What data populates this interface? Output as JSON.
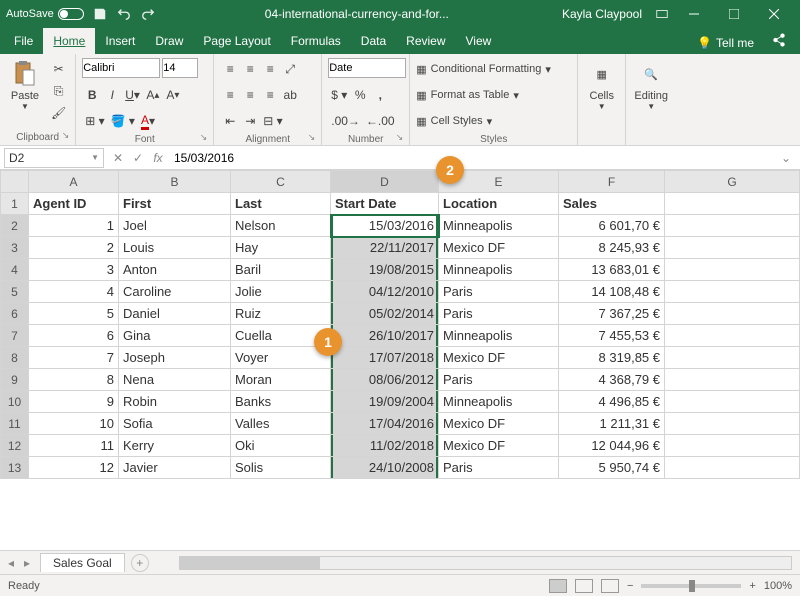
{
  "title": {
    "autosave": "AutoSave",
    "filename": "04-international-currency-and-for...",
    "user": "Kayla Claypool"
  },
  "tabs": {
    "file": "File",
    "home": "Home",
    "insert": "Insert",
    "draw": "Draw",
    "pagelayout": "Page Layout",
    "formulas": "Formulas",
    "data": "Data",
    "review": "Review",
    "view": "View",
    "tellme": "Tell me"
  },
  "ribbon": {
    "clipboard": {
      "paste": "Paste",
      "label": "Clipboard"
    },
    "font": {
      "name": "Calibri",
      "size": "14",
      "label": "Font"
    },
    "alignment": {
      "label": "Alignment"
    },
    "number": {
      "format": "Date",
      "label": "Number"
    },
    "styles": {
      "cond": "Conditional Formatting",
      "table": "Format as Table",
      "cell": "Cell Styles",
      "label": "Styles"
    },
    "cells": {
      "label": "Cells"
    },
    "editing": {
      "label": "Editing"
    }
  },
  "namebox": "D2",
  "formula": "15/03/2016",
  "columns": [
    "A",
    "B",
    "C",
    "D",
    "E",
    "F",
    "G"
  ],
  "headers": {
    "A": "Agent ID",
    "B": "First",
    "C": "Last",
    "D": "Start Date",
    "E": "Location",
    "F": "Sales"
  },
  "rows": [
    {
      "n": "2",
      "id": "1",
      "first": "Joel",
      "last": "Nelson",
      "date": "15/03/2016",
      "loc": "Minneapolis",
      "sales": "6 601,70 €"
    },
    {
      "n": "3",
      "id": "2",
      "first": "Louis",
      "last": "Hay",
      "date": "22/11/2017",
      "loc": "Mexico DF",
      "sales": "8 245,93 €"
    },
    {
      "n": "4",
      "id": "3",
      "first": "Anton",
      "last": "Baril",
      "date": "19/08/2015",
      "loc": "Minneapolis",
      "sales": "13 683,01 €"
    },
    {
      "n": "5",
      "id": "4",
      "first": "Caroline",
      "last": "Jolie",
      "date": "04/12/2010",
      "loc": "Paris",
      "sales": "14 108,48 €"
    },
    {
      "n": "6",
      "id": "5",
      "first": "Daniel",
      "last": "Ruiz",
      "date": "05/02/2014",
      "loc": "Paris",
      "sales": "7 367,25 €"
    },
    {
      "n": "7",
      "id": "6",
      "first": "Gina",
      "last": "Cuella",
      "date": "26/10/2017",
      "loc": "Minneapolis",
      "sales": "7 455,53 €"
    },
    {
      "n": "8",
      "id": "7",
      "first": "Joseph",
      "last": "Voyer",
      "date": "17/07/2018",
      "loc": "Mexico DF",
      "sales": "8 319,85 €"
    },
    {
      "n": "9",
      "id": "8",
      "first": "Nena",
      "last": "Moran",
      "date": "08/06/2012",
      "loc": "Paris",
      "sales": "4 368,79 €"
    },
    {
      "n": "10",
      "id": "9",
      "first": "Robin",
      "last": "Banks",
      "date": "19/09/2004",
      "loc": "Minneapolis",
      "sales": "4 496,85 €"
    },
    {
      "n": "11",
      "id": "10",
      "first": "Sofia",
      "last": "Valles",
      "date": "17/04/2016",
      "loc": "Mexico DF",
      "sales": "1 211,31 €"
    },
    {
      "n": "12",
      "id": "11",
      "first": "Kerry",
      "last": "Oki",
      "date": "11/02/2018",
      "loc": "Mexico DF",
      "sales": "12 044,96 €"
    },
    {
      "n": "13",
      "id": "12",
      "first": "Javier",
      "last": "Solis",
      "date": "24/10/2008",
      "loc": "Paris",
      "sales": "5 950,74 €"
    }
  ],
  "sheet": "Sales Goal",
  "status": {
    "ready": "Ready",
    "zoom": "100%"
  },
  "callouts": {
    "c1": "1",
    "c2": "2"
  }
}
